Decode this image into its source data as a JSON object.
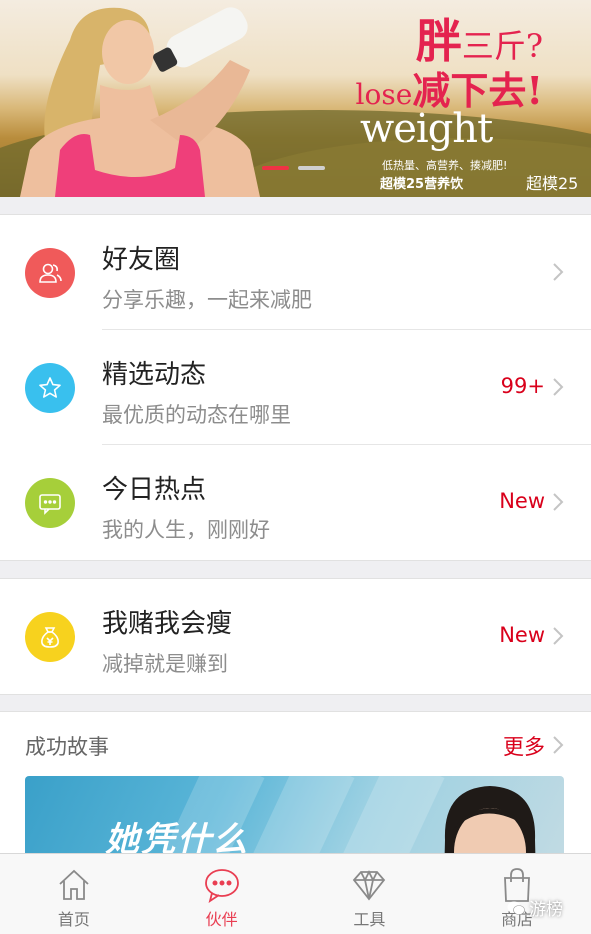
{
  "banner": {
    "title_big": "胖",
    "title_small": "三斤?",
    "line2_lose": "lose",
    "line2_cn": "减下去!",
    "word": "weight",
    "sub1": "低热量、高营养、揍减肥!",
    "sub2": "超模25营养饮",
    "logo": "超模25",
    "slide_index": 0,
    "slide_count": 2
  },
  "groups": [
    {
      "rows": [
        {
          "title": "好友圈",
          "subtitle": "分享乐趣，一起来减肥",
          "badge": "",
          "icon": "people-icon",
          "color": "#f05a5a"
        },
        {
          "title": "精选动态",
          "subtitle": "最优质的动态在哪里",
          "badge": "99+",
          "icon": "star-icon",
          "color": "#39c0ee"
        },
        {
          "title": "今日热点",
          "subtitle": "我的人生，刚刚好",
          "badge": "New",
          "icon": "chat-icon",
          "color": "#a6cf3a"
        }
      ]
    },
    {
      "rows": [
        {
          "title": "我赌我会瘦",
          "subtitle": "减掉就是赚到",
          "badge": "New",
          "icon": "moneybag-icon",
          "color": "#f7d21e"
        }
      ]
    }
  ],
  "stories": {
    "label": "成功故事",
    "more": "更多",
    "card_headline": "她凭什么"
  },
  "tabs": [
    {
      "label": "首页",
      "icon": "home-icon",
      "active": false
    },
    {
      "label": "伙伴",
      "icon": "chat-bubble-icon",
      "active": true
    },
    {
      "label": "工具",
      "icon": "diamond-icon",
      "active": false
    },
    {
      "label": "商店",
      "icon": "shopping-bag-icon",
      "active": false
    }
  ],
  "watermark": "游榜",
  "colors": {
    "accent": "#e93e52",
    "badge_red": "#d9001b",
    "background": "#efeff2"
  }
}
